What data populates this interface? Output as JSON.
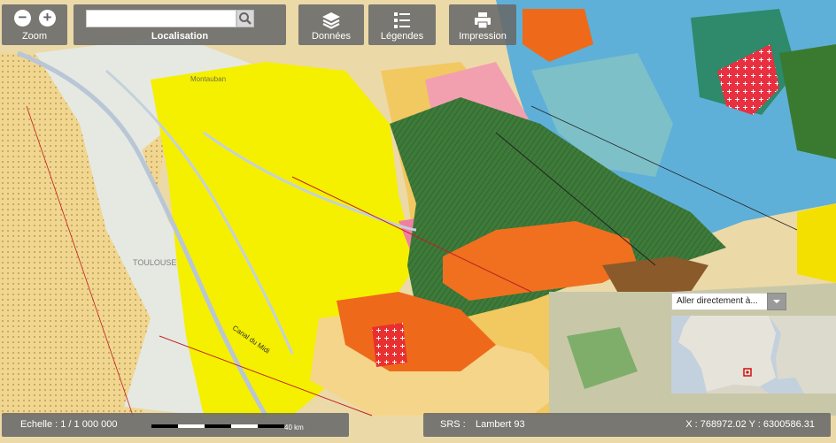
{
  "toolbar": {
    "zoom_label": "Zoom",
    "localisation_label": "Localisation",
    "search_value": "",
    "donnees_label": "Données",
    "legendes_label": "Légendes",
    "impression_label": "Impression"
  },
  "map_labels": {
    "toulouse": "TOULOUSE",
    "montauban": "Montauban",
    "canal_du_midi": "Canal du Midi"
  },
  "footer": {
    "echelle": "Echelle : 1 / 1 000 000",
    "scale_bar_label": "40 km",
    "srs_label": "SRS :",
    "srs_value": "Lambert 93",
    "coordinates": "X : 768972.02 Y : 6300586.31"
  },
  "minimap": {
    "goto_placeholder": "Aller directement à..."
  },
  "colors": {
    "panel_bg": "#696969",
    "yellow_unit": "#f4f000",
    "orange_unit": "#f08020",
    "green_unit": "#3e7a3a",
    "blue_unit": "#5fb0d8",
    "red_unit": "#e83030"
  },
  "icons": [
    "zoom-out-icon",
    "zoom-in-icon",
    "search-icon",
    "layers-icon",
    "legend-list-icon",
    "printer-icon",
    "chevron-down-icon"
  ]
}
